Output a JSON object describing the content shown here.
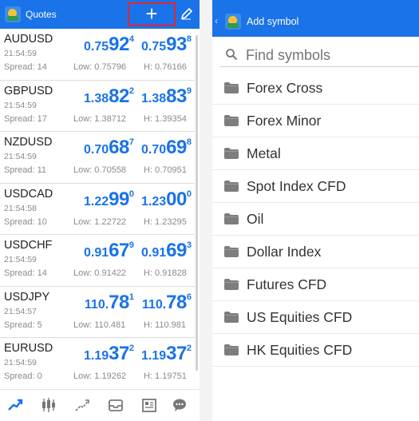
{
  "quotes_screen": {
    "title": "Quotes",
    "add_label": "+",
    "rows": [
      {
        "symbol": "AUDUSD",
        "time": "21:54:59",
        "spread": "Spread: 14",
        "low": "Low: 0.75796",
        "high": "H: 0.76166",
        "bid": {
          "pre": "0.75",
          "big": "92",
          "sup": "4"
        },
        "ask": {
          "pre": "0.75",
          "big": "93",
          "sup": "8"
        }
      },
      {
        "symbol": "GBPUSD",
        "time": "21:54:59",
        "spread": "Spread: 17",
        "low": "Low: 1.38712",
        "high": "H: 1.39354",
        "bid": {
          "pre": "1.38",
          "big": "82",
          "sup": "2"
        },
        "ask": {
          "pre": "1.38",
          "big": "83",
          "sup": "9"
        }
      },
      {
        "symbol": "NZDUSD",
        "time": "21:54:59",
        "spread": "Spread: 11",
        "low": "Low: 0.70558",
        "high": "H: 0.70951",
        "bid": {
          "pre": "0.70",
          "big": "68",
          "sup": "7"
        },
        "ask": {
          "pre": "0.70",
          "big": "69",
          "sup": "8"
        }
      },
      {
        "symbol": "USDCAD",
        "time": "21:54:58",
        "spread": "Spread: 10",
        "low": "Low: 1.22722",
        "high": "H: 1.23295",
        "bid": {
          "pre": "1.22",
          "big": "99",
          "sup": "0"
        },
        "ask": {
          "pre": "1.23",
          "big": "00",
          "sup": "0"
        }
      },
      {
        "symbol": "USDCHF",
        "time": "21:54:59",
        "spread": "Spread: 14",
        "low": "Low: 0.91422",
        "high": "H: 0.91828",
        "bid": {
          "pre": "0.91",
          "big": "67",
          "sup": "9"
        },
        "ask": {
          "pre": "0.91",
          "big": "69",
          "sup": "3"
        }
      },
      {
        "symbol": "USDJPY",
        "time": "21:54:57",
        "spread": "Spread: 5",
        "low": "Low: 110.481",
        "high": "H: 110.981",
        "bid": {
          "pre": "110.",
          "big": "78",
          "sup": "1"
        },
        "ask": {
          "pre": "110.",
          "big": "78",
          "sup": "6"
        }
      },
      {
        "symbol": "EURUSD",
        "time": "21:54:59",
        "spread": "Spread: 0",
        "low": "Low: 1.19262",
        "high": "H: 1.19751",
        "bid": {
          "pre": "1.19",
          "big": "37",
          "sup": "2"
        },
        "ask": {
          "pre": "1.19",
          "big": "37",
          "sup": "2"
        }
      }
    ],
    "bottom_nav": [
      "quotes-icon",
      "chart-icon",
      "trade-icon",
      "history-icon",
      "news-icon",
      "messages-icon"
    ]
  },
  "add_symbol_screen": {
    "title": "Add symbol",
    "back_label": "‹",
    "search": {
      "placeholder": "Find symbols"
    },
    "folders": [
      {
        "label": "Forex Cross"
      },
      {
        "label": "Forex Minor"
      },
      {
        "label": "Metal"
      },
      {
        "label": "Spot Index CFD"
      },
      {
        "label": "Oil"
      },
      {
        "label": "Dollar Index"
      },
      {
        "label": "Futures CFD"
      },
      {
        "label": "US Equities CFD"
      },
      {
        "label": "HK Equities CFD"
      }
    ]
  },
  "colors": {
    "accent": "#1a73e8",
    "highlight_box": "#e3262e",
    "muted_text": "#8a8a8a",
    "folder": "#7d7d7d"
  }
}
